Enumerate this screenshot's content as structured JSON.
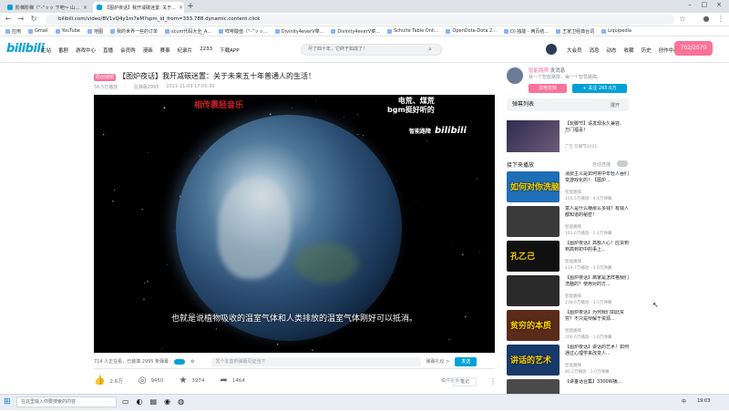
{
  "browser": {
    "tabs": [
      {
        "label": "阶梯阶梯（“-”ッッ 下吧～ 山...",
        "active": false
      },
      {
        "label": "【图炉夜话】我开减碳迷置: 关于...",
        "active": true
      }
    ],
    "new_tab": "+",
    "url": "bilibili.com/video/BV1vQ4y1m7eM?spm_id_from=333.788.dynamic.content.click",
    "bookmarks": [
      "应用",
      "Gmail",
      "YouTube",
      "地图",
      "我的世界一些的订单",
      "scum代码大全_A...",
      "咩啡酸值（“-”ッッ...",
      "Divinity4everV菜...",
      "Divinity4everV菜...",
      "Schulte Table Onli...",
      "OpenDota-Dota 2...",
      "D) 独能 - 两页结...",
      "王家卫经典台词",
      "Liquipedia"
    ]
  },
  "header": {
    "logo": "bilibili",
    "nav": [
      "主站",
      "番剧",
      "游戏中心",
      "直播",
      "会员购",
      "漫画",
      "赛事",
      "纪录片",
      "2233",
      "下载APP"
    ],
    "search_placeholder": "尽了四十年，它终于如成了！",
    "right": [
      "大会员",
      "消息",
      "动态",
      "收藏",
      "历史",
      "创作中心"
    ],
    "upload": "702/2070"
  },
  "video": {
    "badge": "原创视频",
    "title": "【图炉夜话】我开减碳迷置：关于未来五十年普通人的生活！",
    "meta": [
      "56.5万播放",
      "·",
      "总弹幕2995",
      "2021-11-09 17:00:30"
    ],
    "overlay_red": "相传裹胫音乐",
    "overlay_white_1": "电荒、煤荒",
    "overlay_white_2": "bgm挺好听的",
    "overlay_brand_text": "智能路障",
    "overlay_brand_logo": "bilibili",
    "subtitle": "也就是说植物吸收的温室气体和人类排放的温室气体刚好可以抵消。"
  },
  "danmaku_bar": {
    "viewers": "714 人正在看，已装填 2995 条弹幕",
    "placeholder": "发个友善的弹幕见证当下",
    "etiquette": "弹幕礼仪 >",
    "send": "发送"
  },
  "toolbar": {
    "like": "2.6万",
    "coin": "9450",
    "fav": "3974",
    "share": "1464",
    "report": "稿件投诉",
    "notes": "笔记",
    "more": "⋮"
  },
  "uploader": {
    "name": "智能路障",
    "desc": "发消息",
    "sub_desc": "我一个智能路障，每一个智慧路障。",
    "charge": "充电支持",
    "follow": "+ 关注 265.6万"
  },
  "sidebar": {
    "danmaku_list": "弹幕列表",
    "expand": "展开",
    "ad_title": "【玩脚节】请发现永久兼容、万门福喜！",
    "ad_sub": "广告 玩脚节2021",
    "autoplay_title": "接下来播放",
    "autoplay_label": "自动连播",
    "recs": [
      {
        "title": "消费主义是如何将中年轻人吞们变游戏化的！【图炉...",
        "author": "智能路障",
        "stats": "105.5万播放 · 4.4万弹幕",
        "thumb_text": "如何对你洗脑"
      },
      {
        "title": "富人是什么赚那么多钱？有钱人都知道的秘密！",
        "author": "智能路障",
        "stats": "161.6万播放 · 1.4万弹幕",
        "thumb_text": ""
      },
      {
        "title": "【图炉夜话】高额人心！应货到到高到初中的事上...",
        "author": "智能路障",
        "stats": "419.7万播放 · 3.6万弹幕",
        "thumb_text": "孔乙己"
      },
      {
        "title": "【图炉夜话】离家是怎样格我们洗脑的？使用对的方...",
        "author": "智能路障",
        "stats": "238.6万播放 · 3.5万弹幕",
        "thumb_text": ""
      },
      {
        "title": "【图炉夜话】为何我们如此贫穷？不只是辩解于资源...",
        "author": "智能路障",
        "stats": "206.6万播放 · 1.6万弹幕",
        "thumb_text": "贫穷的本质"
      },
      {
        "title": "【图炉夜话】讲话的艺术！如何通过心理学来改变人...",
        "author": "智能路障",
        "stats": "80.2万播放 · 1.0万弹幕",
        "thumb_text": "讲话的艺术"
      },
      {
        "title": "【讲垂话合集】3300W播...",
        "author": "",
        "stats": "",
        "thumb_text": ""
      }
    ]
  },
  "taskbar": {
    "search_placeholder": "在这里输入你要搜索的内容",
    "time": "19:03",
    "lang": "中"
  },
  "colors": {
    "brand_blue": "#00a1d6",
    "brand_pink": "#fb7299"
  }
}
